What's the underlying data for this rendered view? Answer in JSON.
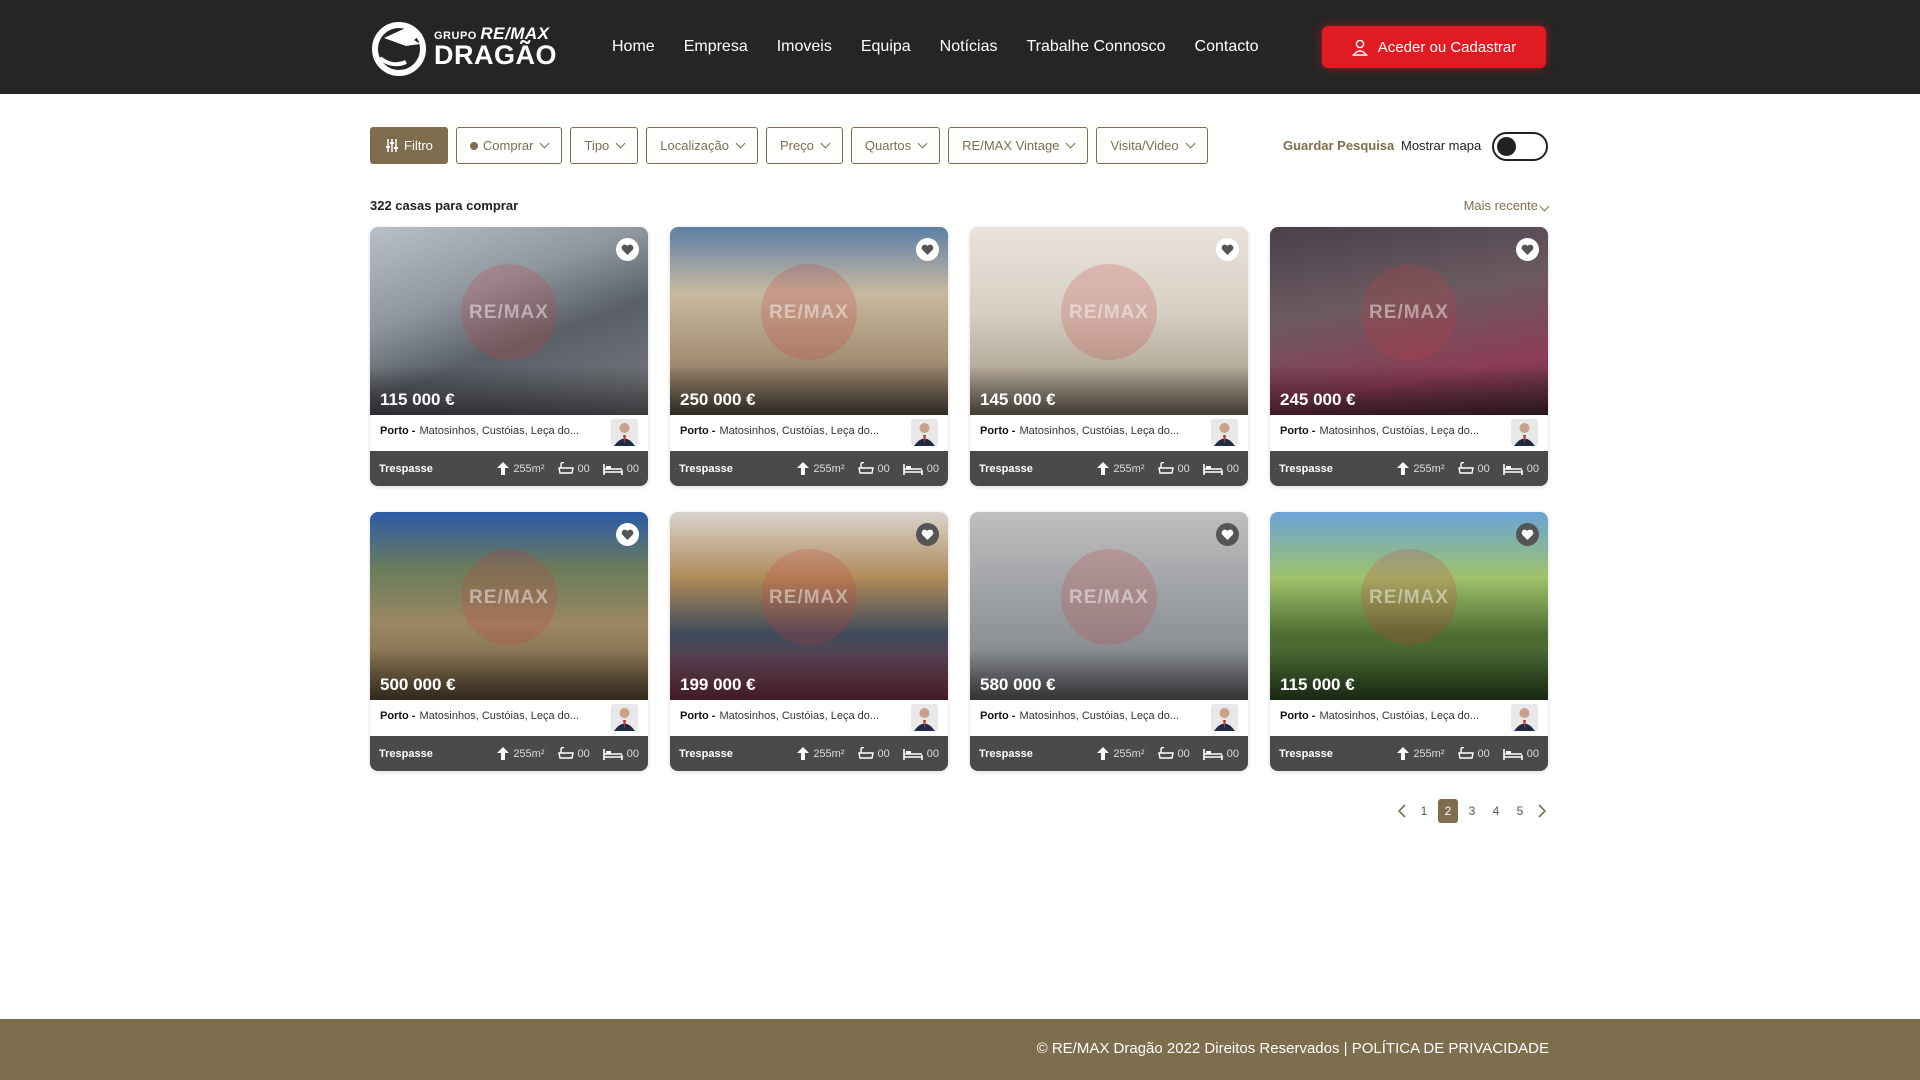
{
  "brand": {
    "small": "GRUPO",
    "remax": "RE/MAX",
    "name": "DRAGÃO"
  },
  "nav": [
    "Home",
    "Empresa",
    "Imoveis",
    "Equipa",
    "Notícias",
    "Trabalhe Connosco",
    "Contacto"
  ],
  "login_label": "Aceder ou Cadastrar",
  "filters": {
    "filter": "Filtro",
    "buy": "Comprar",
    "type": "Tipo",
    "location": "Localização",
    "price": "Preço",
    "rooms": "Quartos",
    "vintage": "RE/MAX Vintage",
    "visit": "Visita/Video"
  },
  "save_search": "Guardar Pesquisa",
  "show_map": "Mostrar mapa",
  "results_count": "322 casas para comprar",
  "sort": "Mais recente",
  "watermark": "RE/MAX",
  "listings": [
    {
      "price": "115 000 €",
      "city": "Porto -",
      "area": "Matosinhos, Custóias, Leça do...",
      "type": "Trespasse",
      "size": "255m²",
      "baths": "00",
      "beds": "00"
    },
    {
      "price": "250 000 €",
      "city": "Porto -",
      "area": "Matosinhos, Custóias, Leça do...",
      "type": "Trespasse",
      "size": "255m²",
      "baths": "00",
      "beds": "00"
    },
    {
      "price": "145 000 €",
      "city": "Porto -",
      "area": "Matosinhos, Custóias, Leça do...",
      "type": "Trespasse",
      "size": "255m²",
      "baths": "00",
      "beds": "00"
    },
    {
      "price": "245 000 €",
      "city": "Porto -",
      "area": "Matosinhos, Custóias, Leça do...",
      "type": "Trespasse",
      "size": "255m²",
      "baths": "00",
      "beds": "00"
    },
    {
      "price": "500 000 €",
      "city": "Porto -",
      "area": "Matosinhos, Custóias, Leça do...",
      "type": "Trespasse",
      "size": "255m²",
      "baths": "00",
      "beds": "00"
    },
    {
      "price": "199 000 €",
      "city": "Porto -",
      "area": "Matosinhos, Custóias, Leça do...",
      "type": "Trespasse",
      "size": "255m²",
      "baths": "00",
      "beds": "00"
    },
    {
      "price": "580 000 €",
      "city": "Porto -",
      "area": "Matosinhos, Custóias, Leça do...",
      "type": "Trespasse",
      "size": "255m²",
      "baths": "00",
      "beds": "00"
    },
    {
      "price": "115 000 €",
      "city": "Porto -",
      "area": "Matosinhos, Custóias, Leça do...",
      "type": "Trespasse",
      "size": "255m²",
      "baths": "00",
      "beds": "00"
    }
  ],
  "pagination": {
    "pages": [
      "1",
      "2",
      "3",
      "4",
      "5"
    ],
    "current": "2"
  },
  "footer": {
    "copyright": "© RE/MAX Dragão 2022 Direitos Reservados | ",
    "privacy": "POLÍTICA DE PRIVACIDADE"
  },
  "colors": {
    "header": "#252525",
    "accent": "#7f6e4e",
    "login": "#e01b22",
    "card_bar": "#4a4a4a"
  }
}
